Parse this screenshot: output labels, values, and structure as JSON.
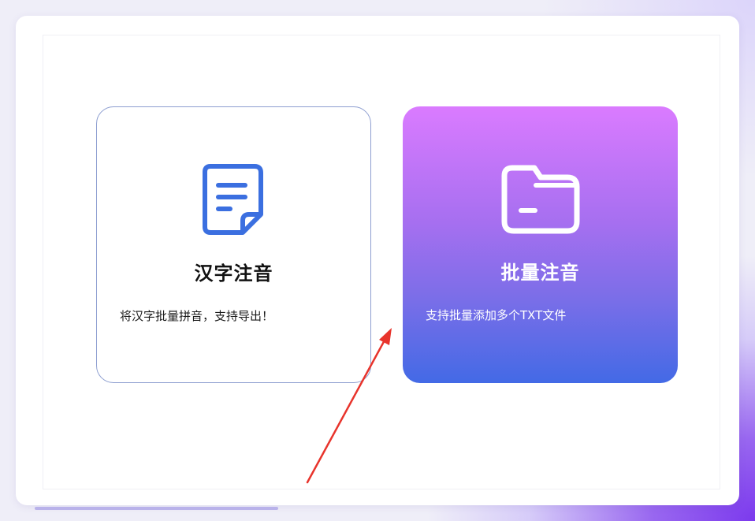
{
  "cards": [
    {
      "id": "hanzi-zhuyin",
      "icon": "document-icon",
      "title": "汉字注音",
      "description": "将汉字批量拼音，支持导出！"
    },
    {
      "id": "batch-zhuyin",
      "icon": "folder-icon",
      "title": "批量注音",
      "description": "支持批量添加多个TXT文件"
    }
  ],
  "colors": {
    "accent_blue": "#3b6fe0",
    "card_gradient_top": "#da7bff",
    "card_gradient_bottom": "#436ae6",
    "annotation_arrow": "#e8342c"
  }
}
